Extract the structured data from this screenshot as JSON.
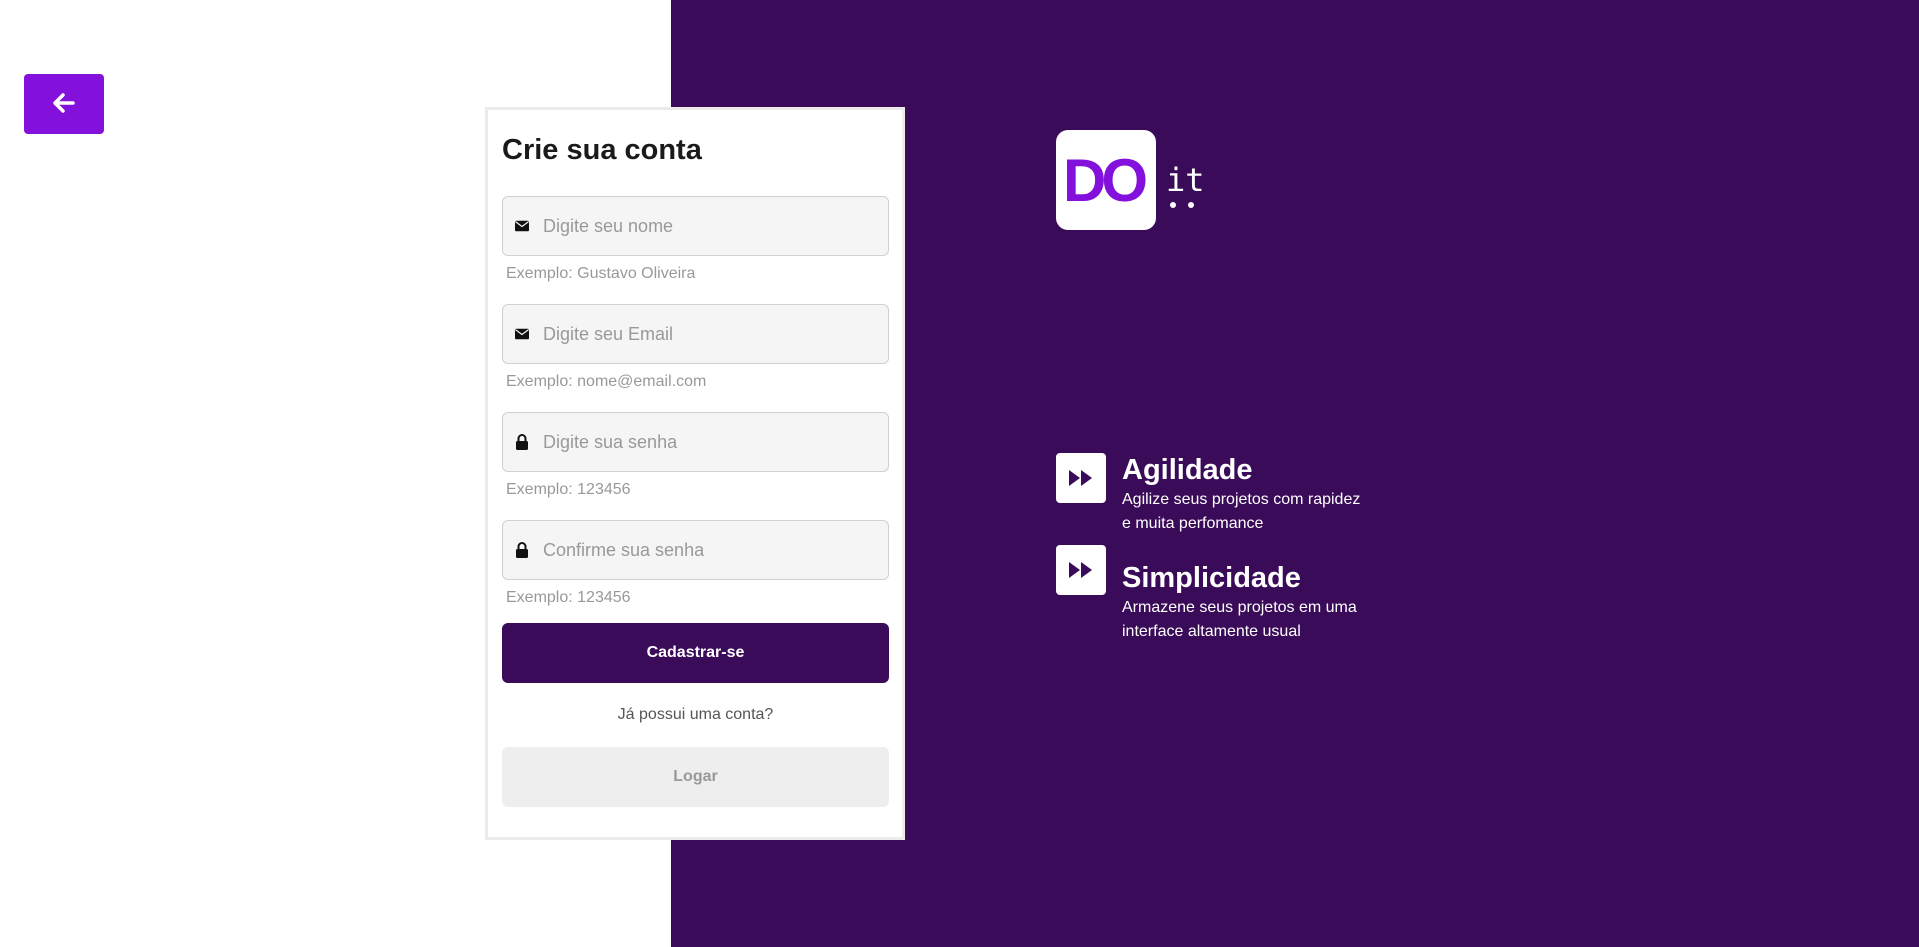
{
  "back_button": {
    "icon": "arrow-left-icon"
  },
  "form": {
    "title": "Crie sua conta",
    "fields": [
      {
        "icon": "envelope-icon",
        "placeholder": "Digite seu nome",
        "hint": "Exemplo: Gustavo Oliveira"
      },
      {
        "icon": "envelope-icon",
        "placeholder": "Digite seu Email",
        "hint": "Exemplo: nome@email.com"
      },
      {
        "icon": "lock-icon",
        "placeholder": "Digite sua senha",
        "hint": "Exemplo: 123456"
      },
      {
        "icon": "lock-icon",
        "placeholder": "Confirme sua senha",
        "hint": "Exemplo: 123456"
      }
    ],
    "submit_label": "Cadastrar-se",
    "has_account_text": "Já possui uma conta?",
    "login_label": "Logar"
  },
  "brand": {
    "logo_main": "DO",
    "logo_suffix": "it"
  },
  "features": [
    {
      "icon": "fast-forward-icon",
      "title": "Agilidade",
      "desc_line1": "Agilize seus projetos com rapidez",
      "desc_line2": "e muita perfomance"
    },
    {
      "icon": "fast-forward-icon",
      "title": "Simplicidade",
      "desc_line1": "Armazene seus projetos em uma",
      "desc_line2": "interface altamente usual"
    }
  ],
  "colors": {
    "accent": "#8410db",
    "dark_purple": "#3a0b58",
    "input_bg": "#f5f5f5",
    "hint_text": "#999999",
    "disabled_button_bg": "#eeeeee"
  }
}
